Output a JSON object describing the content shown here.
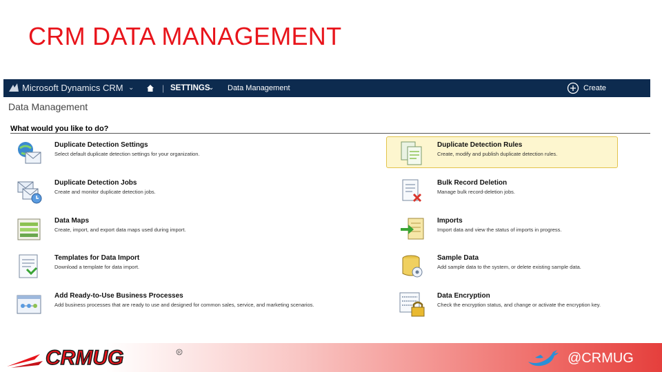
{
  "slide": {
    "title": "CRM DATA MANAGEMENT"
  },
  "navbar": {
    "brand": "Microsoft Dynamics CRM",
    "section": "SETTINGS",
    "breadcrumb": "Data Management",
    "create_label": "Create"
  },
  "page": {
    "heading": "Data Management",
    "question": "What would you like to do?"
  },
  "items": [
    {
      "title": "Duplicate Detection Settings",
      "desc": "Select default duplicate detection settings for your organization.",
      "icon": "globe-envelope-icon"
    },
    {
      "title": "Duplicate Detection Rules",
      "desc": "Create, modify and publish duplicate detection rules.",
      "icon": "documents-check-icon"
    },
    {
      "title": "Duplicate Detection Jobs",
      "desc": "Create and monitor duplicate detection jobs.",
      "icon": "envelopes-clock-icon"
    },
    {
      "title": "Bulk Record Deletion",
      "desc": "Manage bulk record-deletion jobs.",
      "icon": "document-delete-icon"
    },
    {
      "title": "Data Maps",
      "desc": "Create, import, and export data maps used during import.",
      "icon": "data-map-icon"
    },
    {
      "title": "Imports",
      "desc": "Import data and view the status of imports in progress.",
      "icon": "import-icon"
    },
    {
      "title": "Templates for Data Import",
      "desc": "Download a template for data import.",
      "icon": "template-download-icon"
    },
    {
      "title": "Sample Data",
      "desc": "Add sample data to the system, or delete existing sample data.",
      "icon": "flask-icon"
    },
    {
      "title": "Add Ready-to-Use Business Processes",
      "desc": "Add business processes that are ready to use and designed for common sales, service, and marketing scenarios.",
      "icon": "business-process-icon"
    },
    {
      "title": "Data Encryption",
      "desc": "Check the encryption status, and change or activate the encryption key.",
      "icon": "lock-icon"
    }
  ],
  "footer": {
    "logo_text": "CRMUG",
    "handle": "@CRMUG"
  },
  "colors": {
    "accent_red": "#e8141b",
    "nav_bg": "#0d2b4f",
    "highlight_bg": "#fdf6cf",
    "highlight_border": "#e2c34a"
  }
}
